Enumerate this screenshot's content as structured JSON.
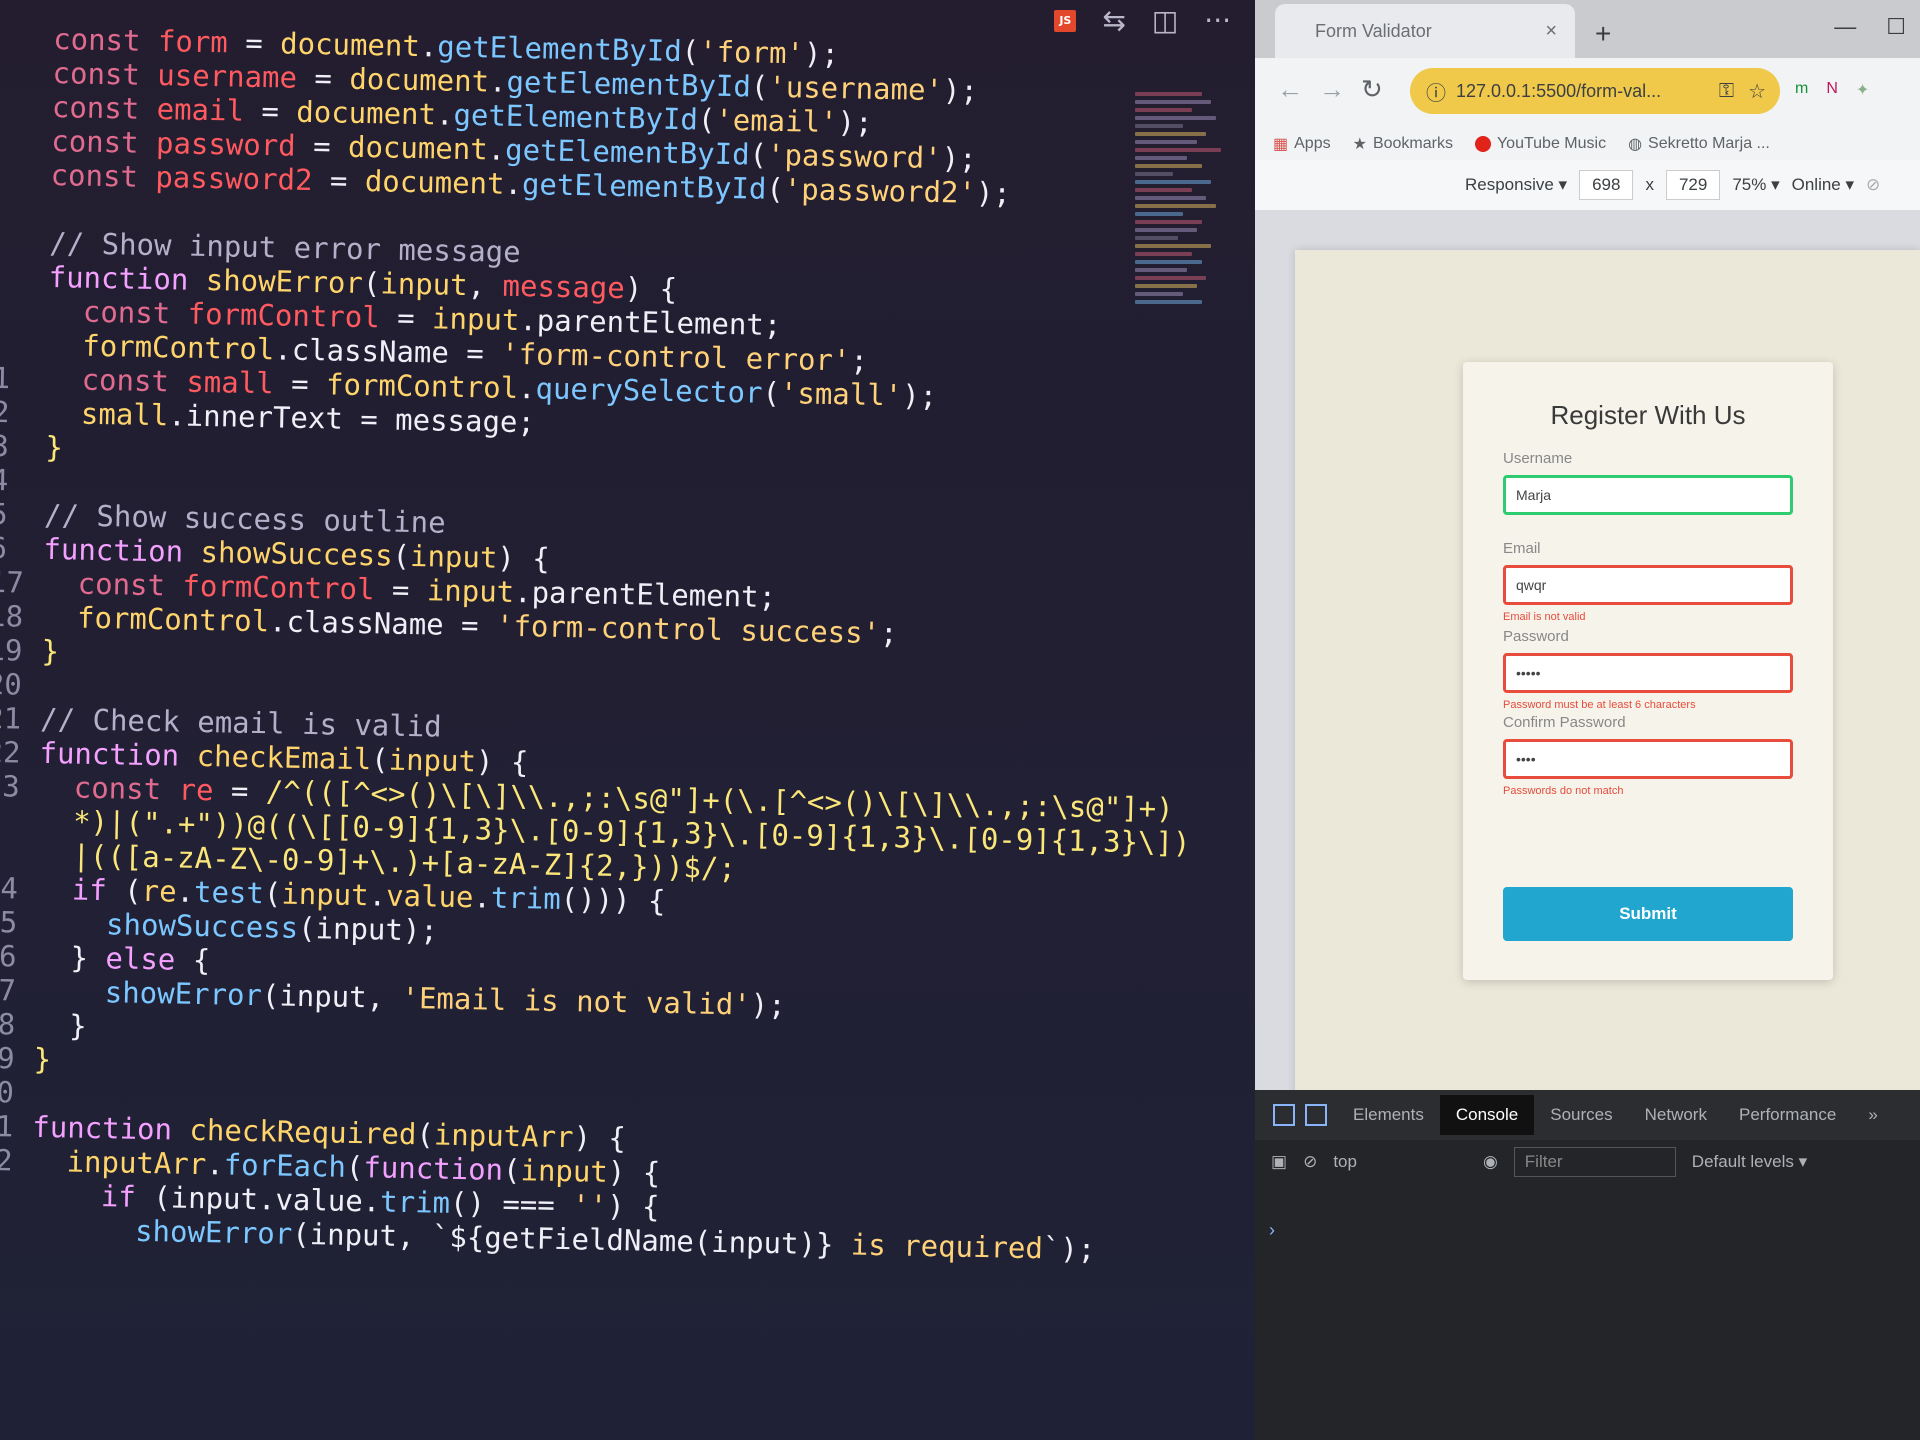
{
  "editor": {
    "actions": [
      "⇆",
      "◫",
      "···"
    ],
    "lines": [
      {
        "n": "",
        "tokens": [
          [
            "kw",
            "const "
          ],
          [
            "v",
            "form"
          ],
          [
            "p",
            " = "
          ],
          [
            "fn",
            "document"
          ],
          [
            "p",
            "."
          ],
          [
            "m",
            "getElementById"
          ],
          [
            "p",
            "("
          ],
          [
            "s",
            "'form'"
          ],
          [
            "p",
            ");"
          ]
        ]
      },
      {
        "n": "",
        "tokens": [
          [
            "kw",
            "const "
          ],
          [
            "v",
            "username"
          ],
          [
            "p",
            " = "
          ],
          [
            "fn",
            "document"
          ],
          [
            "p",
            "."
          ],
          [
            "m",
            "getElementById"
          ],
          [
            "p",
            "("
          ],
          [
            "s",
            "'username'"
          ],
          [
            "p",
            ");"
          ]
        ]
      },
      {
        "n": "",
        "tokens": [
          [
            "kw",
            "const "
          ],
          [
            "v",
            "email"
          ],
          [
            "p",
            " = "
          ],
          [
            "fn",
            "document"
          ],
          [
            "p",
            "."
          ],
          [
            "m",
            "getElementById"
          ],
          [
            "p",
            "("
          ],
          [
            "s",
            "'email'"
          ],
          [
            "p",
            ");"
          ]
        ]
      },
      {
        "n": "",
        "tokens": [
          [
            "kw",
            "const "
          ],
          [
            "v",
            "password"
          ],
          [
            "p",
            " = "
          ],
          [
            "fn",
            "document"
          ],
          [
            "p",
            "."
          ],
          [
            "m",
            "getElementById"
          ],
          [
            "p",
            "("
          ],
          [
            "s",
            "'password'"
          ],
          [
            "p",
            ");"
          ]
        ]
      },
      {
        "n": "",
        "tokens": [
          [
            "kw",
            "const "
          ],
          [
            "v",
            "password2"
          ],
          [
            "p",
            " = "
          ],
          [
            "fn",
            "document"
          ],
          [
            "p",
            "."
          ],
          [
            "m",
            "getElementById"
          ],
          [
            "p",
            "("
          ],
          [
            "s",
            "'password2'"
          ],
          [
            "p",
            ");"
          ]
        ]
      },
      {
        "n": "",
        "tokens": []
      },
      {
        "n": "",
        "tokens": [
          [
            "c",
            "// Show input error message"
          ]
        ]
      },
      {
        "n": "",
        "tokens": [
          [
            "k",
            "function "
          ],
          [
            "fn",
            "showError"
          ],
          [
            "p",
            "("
          ],
          [
            "fn",
            "input"
          ],
          [
            "p",
            ", "
          ],
          [
            "v",
            "message"
          ],
          [
            "p",
            ") {"
          ]
        ]
      },
      {
        "n": "",
        "tokens": [
          [
            "p",
            "  "
          ],
          [
            "kw",
            "const "
          ],
          [
            "v",
            "formControl"
          ],
          [
            "p",
            " = "
          ],
          [
            "fn",
            "input"
          ],
          [
            "p",
            ".parentElement;"
          ]
        ]
      },
      {
        "n": "",
        "tokens": [
          [
            "p",
            "  "
          ],
          [
            "fn",
            "formControl"
          ],
          [
            "p",
            ".className = "
          ],
          [
            "s",
            "'form-control error'"
          ],
          [
            "p",
            ";"
          ]
        ]
      },
      {
        "n": "1",
        "tokens": [
          [
            "p",
            "  "
          ],
          [
            "kw",
            "const "
          ],
          [
            "v",
            "small"
          ],
          [
            "p",
            " = "
          ],
          [
            "fn",
            "formControl"
          ],
          [
            "p",
            "."
          ],
          [
            "m",
            "querySelector"
          ],
          [
            "p",
            "("
          ],
          [
            "s",
            "'small'"
          ],
          [
            "p",
            ");"
          ]
        ]
      },
      {
        "n": "2",
        "tokens": [
          [
            "p",
            "  "
          ],
          [
            "fn",
            "small"
          ],
          [
            "p",
            ".innerText = message;"
          ]
        ]
      },
      {
        "n": "3",
        "tokens": [
          [
            "r",
            "}"
          ]
        ]
      },
      {
        "n": "4",
        "tokens": []
      },
      {
        "n": "5",
        "tokens": [
          [
            "c",
            "// Show success outline"
          ]
        ]
      },
      {
        "n": "6",
        "tokens": [
          [
            "k",
            "function "
          ],
          [
            "fn",
            "showSuccess"
          ],
          [
            "p",
            "("
          ],
          [
            "fn",
            "input"
          ],
          [
            "p",
            ") {"
          ]
        ]
      },
      {
        "n": "17",
        "tokens": [
          [
            "p",
            "  "
          ],
          [
            "kw",
            "const "
          ],
          [
            "v",
            "formControl"
          ],
          [
            "p",
            " = "
          ],
          [
            "fn",
            "input"
          ],
          [
            "p",
            ".parentElement;"
          ]
        ]
      },
      {
        "n": "18",
        "tokens": [
          [
            "p",
            "  "
          ],
          [
            "fn",
            "formControl"
          ],
          [
            "p",
            ".className = "
          ],
          [
            "s",
            "'form-control success'"
          ],
          [
            "p",
            ";"
          ]
        ]
      },
      {
        "n": "19",
        "tokens": [
          [
            "r",
            "}"
          ]
        ]
      },
      {
        "n": "20",
        "tokens": []
      },
      {
        "n": "21",
        "tokens": [
          [
            "c",
            "// Check email is valid"
          ]
        ]
      },
      {
        "n": "22",
        "tokens": [
          [
            "k",
            "function "
          ],
          [
            "fn",
            "checkEmail"
          ],
          [
            "p",
            "("
          ],
          [
            "fn",
            "input"
          ],
          [
            "p",
            ") {"
          ]
        ]
      },
      {
        "n": "23",
        "tokens": [
          [
            "p",
            "  "
          ],
          [
            "kw",
            "const "
          ],
          [
            "v",
            "re"
          ],
          [
            "p",
            " = "
          ],
          [
            "r",
            "/^(([^<>()\\[\\]\\\\.,;:\\s@\"]+(\\.[^<>()\\[\\]\\\\.,;:\\s@\"]+)"
          ]
        ]
      },
      {
        "n": "",
        "tokens": [
          [
            "r",
            "  *)|(\".+\"))@((\\[[0-9]{1,3}\\.[0-9]{1,3}\\.[0-9]{1,3}\\.[0-9]{1,3}\\])"
          ]
        ]
      },
      {
        "n": "",
        "tokens": [
          [
            "r",
            "  |(([a-zA-Z\\-0-9]+\\.)+[a-zA-Z]{2,}))$/;"
          ]
        ]
      },
      {
        "n": "24",
        "tokens": [
          [
            "p",
            "  "
          ],
          [
            "k",
            "if "
          ],
          [
            "p",
            "("
          ],
          [
            "fn",
            "re"
          ],
          [
            "p",
            "."
          ],
          [
            "m",
            "test"
          ],
          [
            "p",
            "("
          ],
          [
            "fn",
            "input"
          ],
          [
            "p",
            "."
          ],
          [
            "fn",
            "value"
          ],
          [
            "p",
            "."
          ],
          [
            "m",
            "trim"
          ],
          [
            "p",
            "())) {"
          ]
        ]
      },
      {
        "n": "25",
        "tokens": [
          [
            "p",
            "    "
          ],
          [
            "m",
            "showSuccess"
          ],
          [
            "p",
            "(input);"
          ]
        ]
      },
      {
        "n": "26",
        "tokens": [
          [
            "p",
            "  } "
          ],
          [
            "k",
            "else"
          ],
          [
            "p",
            " {"
          ]
        ]
      },
      {
        "n": "27",
        "tokens": [
          [
            "p",
            "    "
          ],
          [
            "m",
            "showError"
          ],
          [
            "p",
            "(input, "
          ],
          [
            "s",
            "'Email is not valid'"
          ],
          [
            "p",
            ");"
          ]
        ]
      },
      {
        "n": "28",
        "tokens": [
          [
            "p",
            "  }"
          ]
        ]
      },
      {
        "n": "29",
        "tokens": [
          [
            "r",
            "}"
          ]
        ]
      },
      {
        "n": "30",
        "tokens": []
      },
      {
        "n": "31",
        "tokens": [
          [
            "k",
            "function "
          ],
          [
            "fn",
            "checkRequired"
          ],
          [
            "p",
            "("
          ],
          [
            "fn",
            "inputArr"
          ],
          [
            "p",
            ") {"
          ]
        ]
      },
      {
        "n": "32",
        "tokens": [
          [
            "p",
            "  "
          ],
          [
            "fn",
            "inputArr"
          ],
          [
            "p",
            "."
          ],
          [
            "m",
            "forEach"
          ],
          [
            "p",
            "("
          ],
          [
            "k",
            "function"
          ],
          [
            "p",
            "("
          ],
          [
            "fn",
            "input"
          ],
          [
            "p",
            ") {"
          ]
        ]
      },
      {
        "n": "",
        "tokens": [
          [
            "p",
            "    "
          ],
          [
            "k",
            "if "
          ],
          [
            "p",
            "(input.value."
          ],
          [
            "m",
            "trim"
          ],
          [
            "p",
            "() === "
          ],
          [
            "s",
            "''"
          ],
          [
            "p",
            ") {"
          ]
        ]
      },
      {
        "n": "",
        "tokens": [
          [
            "p",
            "      "
          ],
          [
            "m",
            "showError"
          ],
          [
            "p",
            "(input, `${getFieldName(input)} "
          ],
          [
            "s",
            "is required"
          ],
          [
            "p",
            "`);"
          ]
        ]
      }
    ]
  },
  "browser": {
    "tab_title": "Form Validator",
    "tab_close": "×",
    "new_tab": "+",
    "window_controls": [
      "—",
      "☐"
    ],
    "url": "127.0.0.1:5500/form-val...",
    "bookmarks": [
      "Apps",
      "Bookmarks",
      "YouTube Music",
      "Sekretto Marja ..."
    ],
    "device_toolbar": {
      "mode": "Responsive ▾",
      "width": "698",
      "times": "x",
      "height": "729",
      "zoom": "75% ▾",
      "network": "Online ▾"
    },
    "form": {
      "title": "Register With Us",
      "fields": [
        {
          "label": "Username",
          "value": "Marja",
          "state": "success",
          "message": ""
        },
        {
          "label": "Email",
          "value": "qwqr",
          "state": "error",
          "message": "Email is not valid"
        },
        {
          "label": "Password",
          "value": "•••••",
          "state": "error",
          "message": "Password must be at least 6 characters"
        },
        {
          "label": "Confirm Password",
          "value": "••••",
          "state": "error",
          "message": "Passwords do not match"
        }
      ],
      "submit": "Submit"
    },
    "devtools": {
      "tabs": [
        "Elements",
        "Console",
        "Sources",
        "Network",
        "Performance",
        "»"
      ],
      "active_tab": "Console",
      "context": "top",
      "filter_placeholder": "Filter",
      "levels": "Default levels ▾",
      "prompt": "›"
    }
  }
}
